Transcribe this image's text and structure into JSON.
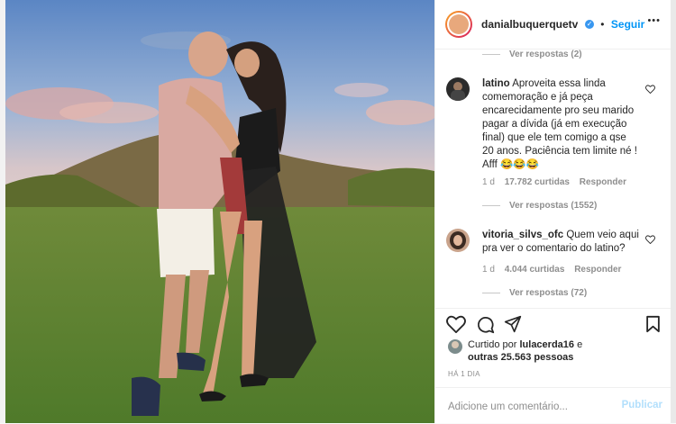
{
  "post": {
    "account": "danialbuquerquetv",
    "follow_label": "Seguir",
    "more_label": "•••",
    "view_replies_top": "Ver respostas (2)",
    "comments": [
      {
        "user": "latino",
        "text": "Aproveita essa linda comemoração e já peça encarecidamente pro seu marido pagar a dívida (já em execução final) que ele tem comigo a qse 20 anos. Paciência tem limite né ! Afff 😂😂😂",
        "age": "1 d",
        "likes": "17.782 curtidas",
        "reply": "Responder",
        "view_replies": "Ver respostas (1552)"
      },
      {
        "user": "vitoria_silvs_ofc",
        "text": "Quem veio aqui pra ver o comentario do latino?",
        "age": "1 d",
        "likes": "4.044 curtidas",
        "reply": "Responder",
        "view_replies": "Ver respostas (72)"
      }
    ],
    "liked_prefix": "Curtido por",
    "liked_user": "lulacerda16",
    "liked_and": "e",
    "liked_others": "outras 25.563 pessoas",
    "posted_ago": "HÁ 1 DIA",
    "comment_placeholder": "Adicione um comentário...",
    "publish_label": "Publicar"
  },
  "colors": {
    "link_blue": "#0095f6",
    "verified": "#3897f0",
    "muted": "#8e8e8e",
    "publish_disabled": "#b2dffc"
  }
}
